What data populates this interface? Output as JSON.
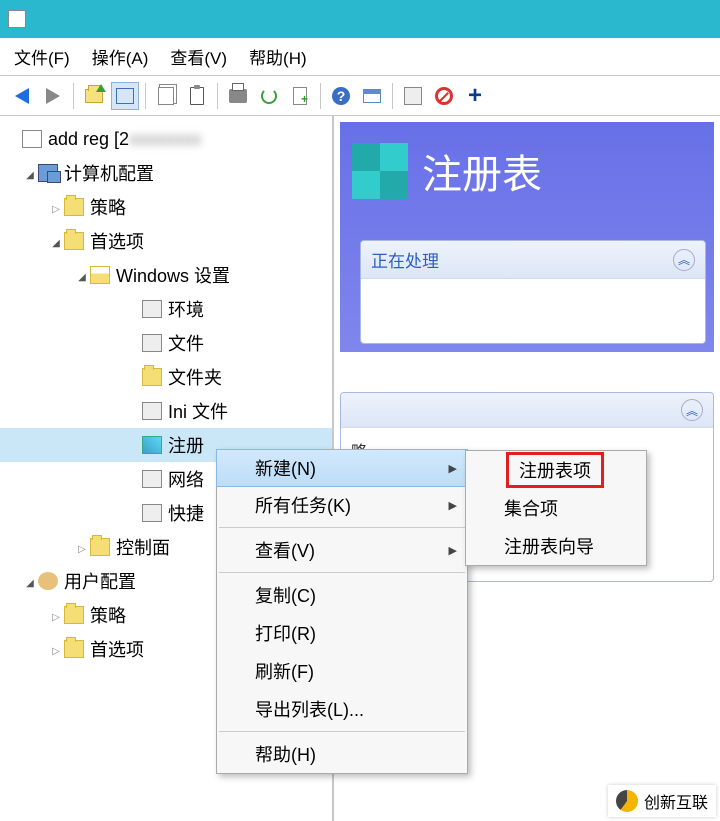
{
  "menu": {
    "file": "文件(F)",
    "action": "操作(A)",
    "view": "查看(V)",
    "help": "帮助(H)"
  },
  "tree": {
    "root": "add reg [2",
    "computer_config": "计算机配置",
    "policies1": "策略",
    "preferences1": "首选项",
    "windows_settings": "Windows 设置",
    "env": "环境",
    "files": "文件",
    "folders": "文件夹",
    "ini": "Ini 文件",
    "registry": "注册",
    "net": "网络",
    "shortcut": "快捷",
    "ctrlpanel": "控制面",
    "user_config": "用户配置",
    "policies2": "策略",
    "preferences2": "首选项"
  },
  "right": {
    "title": "注册表",
    "processing": "正在处理",
    "collapse_glyph": "︽",
    "desc_body": "略"
  },
  "context": {
    "new": "新建(N)",
    "all_tasks": "所有任务(K)",
    "view": "查看(V)",
    "copy": "复制(C)",
    "print": "打印(R)",
    "refresh": "刷新(F)",
    "export": "导出列表(L)...",
    "help": "帮助(H)"
  },
  "submenu": {
    "reg_item": "注册表项",
    "collection": "集合项",
    "reg_wizard": "注册表向导"
  },
  "watermark": "创新互联"
}
